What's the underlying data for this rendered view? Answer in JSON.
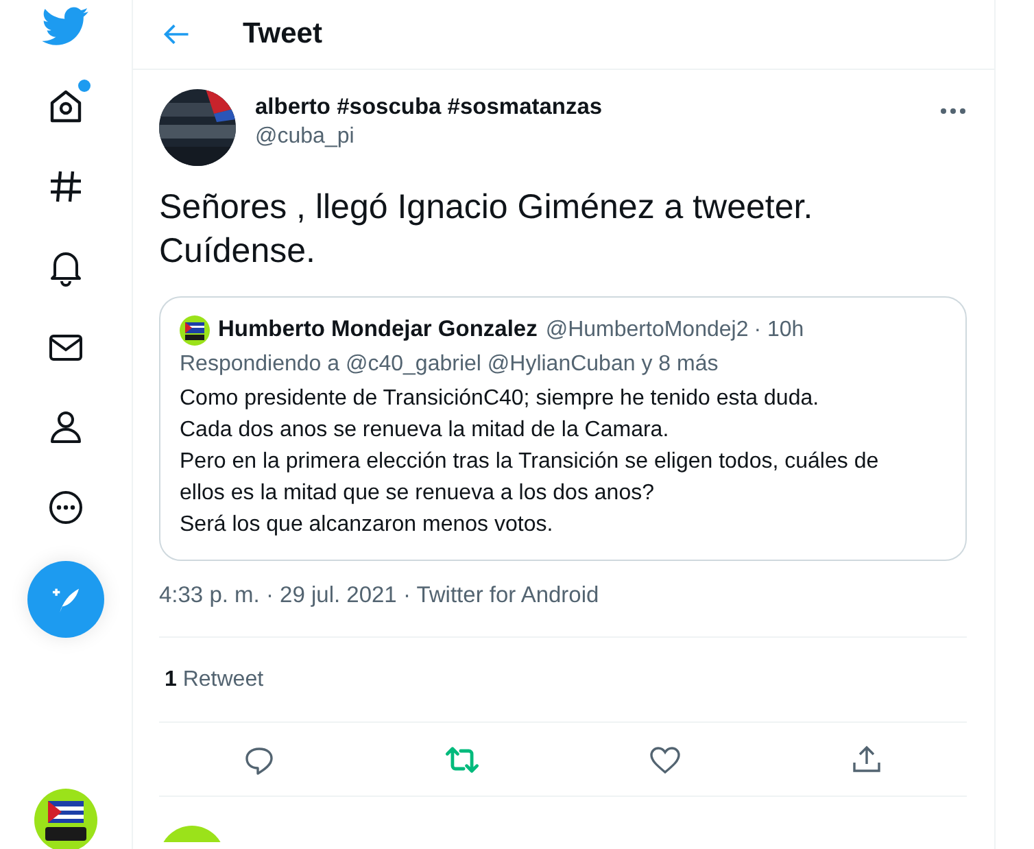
{
  "header": {
    "title": "Tweet"
  },
  "nav": [
    {
      "kind": "home",
      "dot": true
    },
    {
      "kind": "explore",
      "dot": false
    },
    {
      "kind": "notifications",
      "dot": false
    },
    {
      "kind": "messages",
      "dot": false
    },
    {
      "kind": "profile",
      "dot": false
    },
    {
      "kind": "more",
      "dot": false
    }
  ],
  "tweet": {
    "name": "alberto #soscuba #sosmatanzas",
    "handle": "@cuba_pi",
    "text": "Señores , llegó Ignacio Giménez a tweeter. Cuídense.",
    "quote": {
      "name": "Humberto Mondejar Gonzalez",
      "handle": "@HumbertoMondej2",
      "time": "· 10h",
      "replying": "Respondiendo a @c40_gabriel @HylianCuban y 8 más",
      "lines": [
        "Como presidente de TransiciónC40; siempre he tenido esta duda.",
        "Cada dos anos se renueva la mitad de la Camara.",
        "Pero en la primera elección tras la Transición se eligen todos, cuáles de ellos es la mitad que se renueva a los dos anos?",
        "Será los que alcanzaron menos votos."
      ]
    },
    "meta": "4:33 p. m. · 29 jul. 2021 · Twitter for Android",
    "stats": {
      "count": "1",
      "label": "Retweet"
    },
    "retweeted": true
  }
}
